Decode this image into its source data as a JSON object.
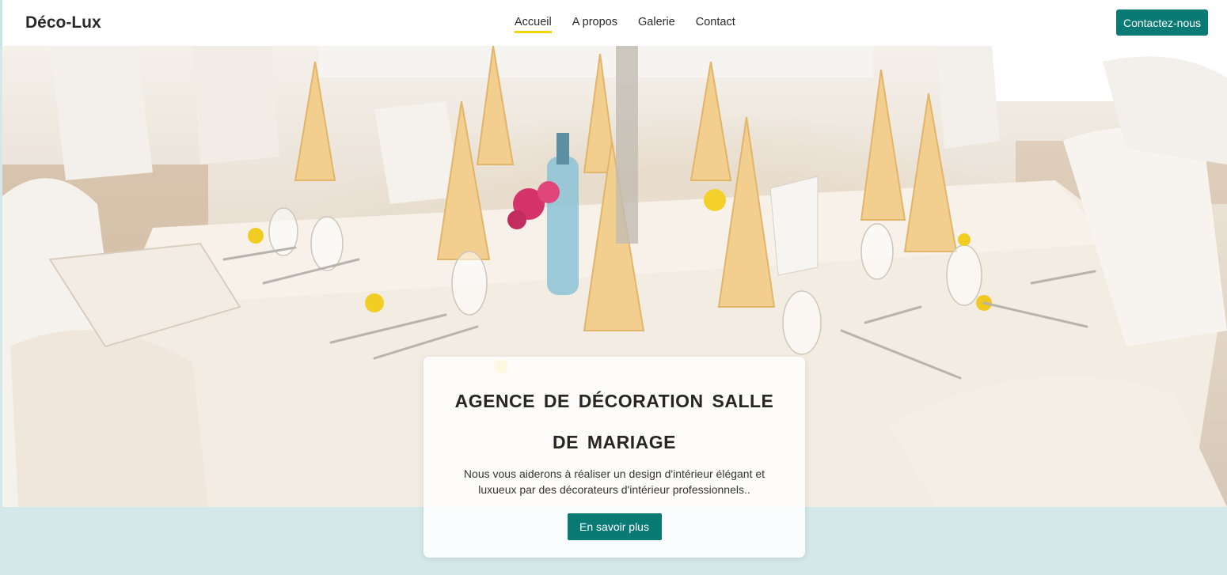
{
  "brand": {
    "logo": "Déco-Lux"
  },
  "nav": {
    "items": [
      {
        "label": "Accueil",
        "active": true
      },
      {
        "label": "A propos",
        "active": false
      },
      {
        "label": "Galerie",
        "active": false
      },
      {
        "label": "Contact",
        "active": false
      }
    ],
    "cta_label": "Contactez-nous"
  },
  "hero": {
    "image": "wedding reception table with folded napkins, glasses and flowers",
    "title": "AGENCE DE DÉCORATION SALLE DE MARIAGE",
    "description": "Nous vous aiderons à réaliser un design d'intérieur élégant et luxueux par des décorateurs d'intérieur professionnels..",
    "cta_label": "En savoir plus"
  },
  "colors": {
    "accent": "#0a7a75",
    "nav_underline": "#f2d600",
    "page_background": "#d3e8e8"
  }
}
